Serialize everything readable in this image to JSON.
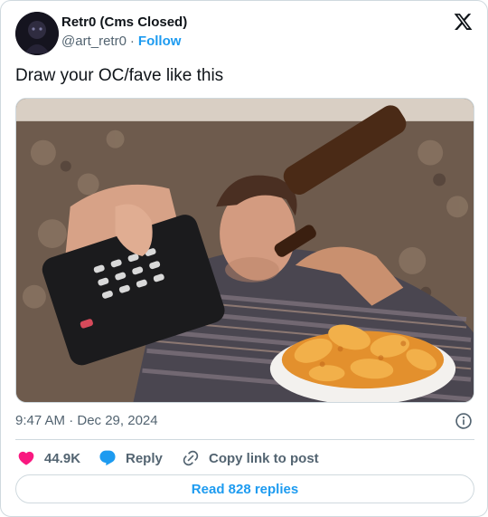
{
  "author": {
    "display_name": "Retr0 (Cms Closed)",
    "handle": "@art_retr0",
    "separator": "·",
    "follow_label": "Follow"
  },
  "brand_icon": "x-logo-icon",
  "tweet": {
    "text": "Draw your OC/fave like this",
    "media_icon": "photo",
    "timestamp": "9:47 AM · Dec 29, 2024"
  },
  "actions": {
    "like": {
      "icon": "heart-icon",
      "count": "44.9K",
      "color": "#f91880"
    },
    "reply": {
      "icon": "speech-bubble-icon",
      "label": "Reply",
      "color": "#1d9bf0"
    },
    "copy": {
      "icon": "link-icon",
      "label": "Copy link to post"
    }
  },
  "read_replies": {
    "label": "Read 828 replies"
  },
  "colors": {
    "accent": "#1d9bf0",
    "text": "#0f1419",
    "muted": "#536471",
    "border": "#cfd9de"
  }
}
